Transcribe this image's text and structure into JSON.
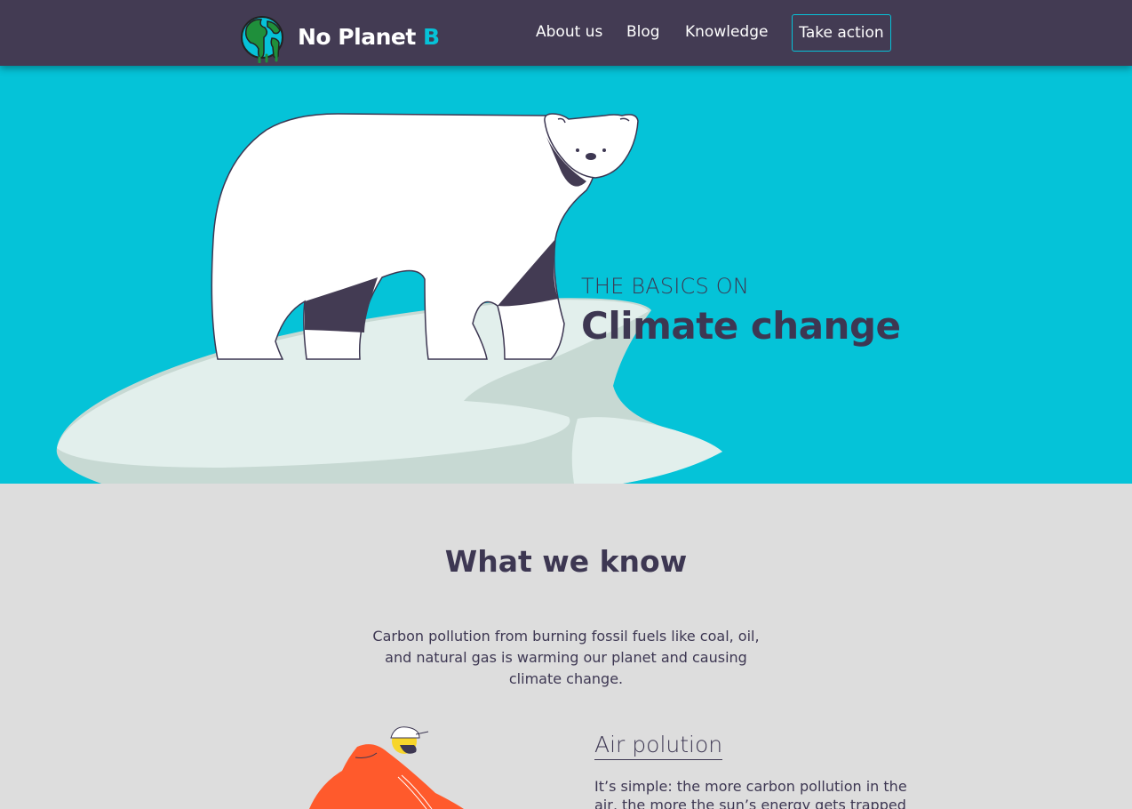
{
  "nav": {
    "brand_main": "No Planet ",
    "brand_accent": "B",
    "links": [
      "About us",
      "Blog",
      "Knowledge"
    ],
    "cta": "Take action"
  },
  "hero": {
    "kicker": "THE BASICS ON",
    "title": "Climate change"
  },
  "section": {
    "title": "What we know",
    "intro": "Carbon pollution from burning fossil fuels like coal, oil, and natural gas is warming our planet and causing climate change."
  },
  "card": {
    "title": "Air polution",
    "text": "It’s simple: the more carbon pollution in the air, the more the sun’s energy gets trapped"
  },
  "colors": {
    "nav_bg": "#433b53",
    "accent": "#06c2d8",
    "hero_bg": "#05c3d8",
    "page_bg": "#dddddd",
    "text": "#3d3752"
  }
}
